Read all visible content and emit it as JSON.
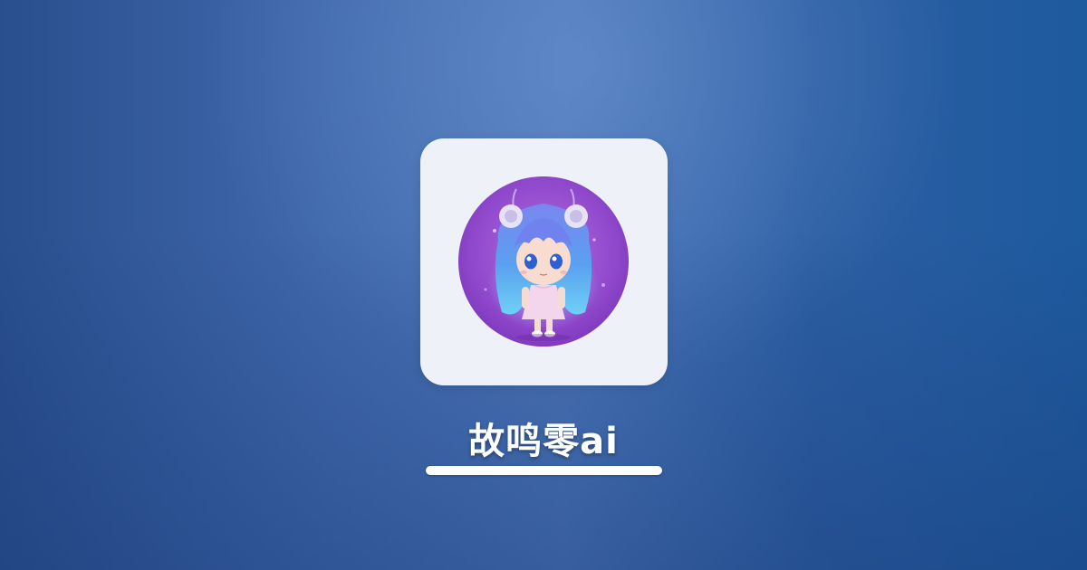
{
  "app": {
    "name": "故鸣零ai"
  },
  "avatar": {
    "icon": "anime-chibi-girl-avatar",
    "background_color": "#9a4fd0"
  },
  "colors": {
    "background_left": "#2a4f8e",
    "background_center": "#4a75b8",
    "background_right": "#1e5a9e",
    "card": "#eef2f8",
    "title_text": "#ffffff",
    "underline": "#ffffff"
  }
}
